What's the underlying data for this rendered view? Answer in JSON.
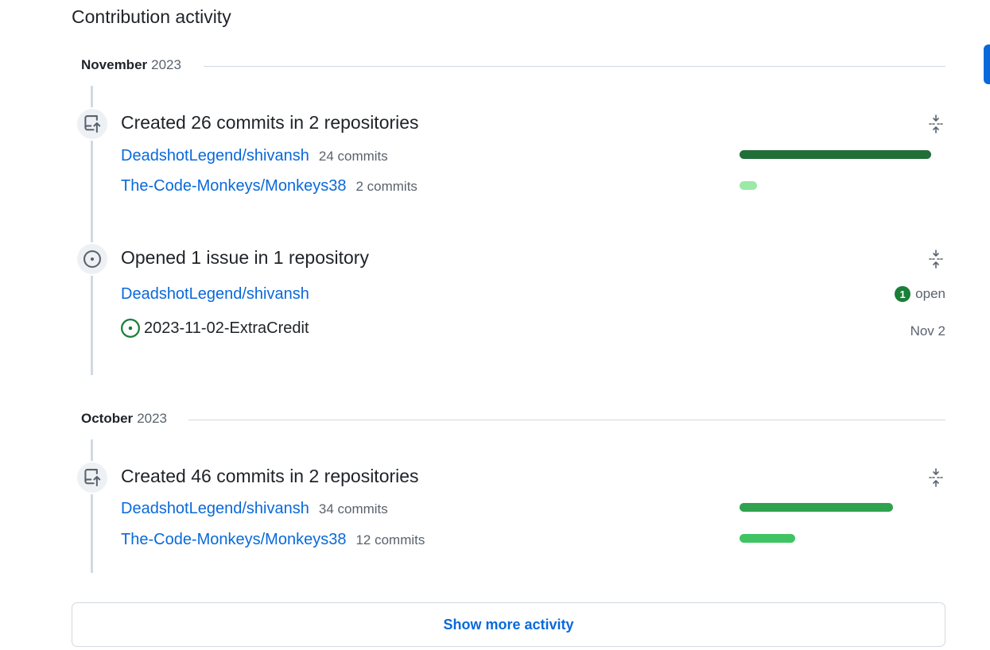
{
  "heading": "Contribution activity",
  "sections": [
    {
      "month": "November",
      "year": "2023",
      "groups": [
        {
          "type": "commits",
          "icon": "repo-push-icon",
          "summary": "Created 26 commits in 2 repositories",
          "repos": [
            {
              "name": "DeadshotLegend/shivansh",
              "count": "24 commits",
              "bar_fraction": 1.0,
              "bar_color": "#216e39"
            },
            {
              "name": "The-Code-Monkeys/Monkeys38",
              "count": "2 commits",
              "bar_fraction": 0.09,
              "bar_color": "#9be9a8"
            }
          ]
        },
        {
          "type": "issues",
          "icon": "issue-opened-icon",
          "summary": "Opened 1 issue in 1 repository",
          "repo": "DeadshotLegend/shivansh",
          "open_count": "1",
          "open_label": "open",
          "issues": [
            {
              "title": "2023-11-02-ExtraCredit",
              "date": "Nov 2",
              "status_color": "#1a7f37"
            }
          ]
        }
      ]
    },
    {
      "month": "October",
      "year": "2023",
      "groups": [
        {
          "type": "commits",
          "icon": "repo-push-icon",
          "summary": "Created 46 commits in 2 repositories",
          "repos": [
            {
              "name": "DeadshotLegend/shivansh",
              "count": "34 commits",
              "bar_fraction": 0.8,
              "bar_color": "#30a14e"
            },
            {
              "name": "The-Code-Monkeys/Monkeys38",
              "count": "12 commits",
              "bar_fraction": 0.29,
              "bar_color": "#40c463"
            }
          ]
        }
      ]
    }
  ],
  "show_more_label": "Show more activity",
  "colors": {
    "link": "#0969da",
    "muted": "#59636e",
    "open_green": "#1a7f37"
  }
}
